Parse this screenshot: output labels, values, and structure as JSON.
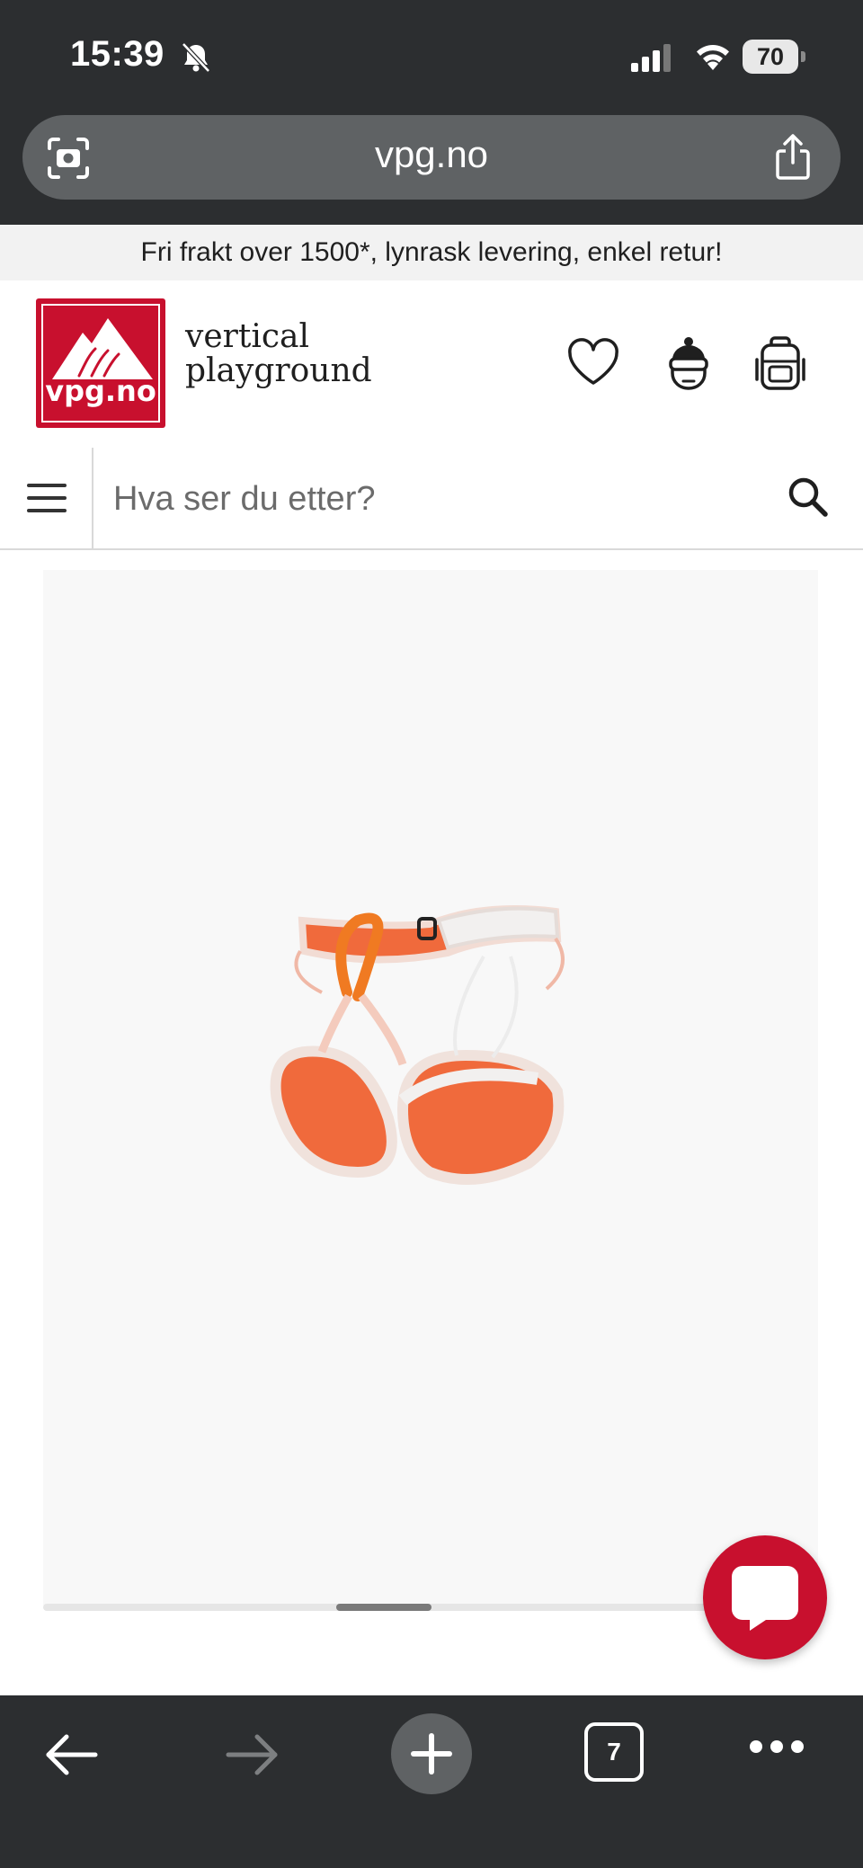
{
  "status_bar": {
    "time": "15:39",
    "battery": "70"
  },
  "browser": {
    "url": "vpg.no",
    "tab_count": "7"
  },
  "promo": {
    "text": "Fri frakt over 1500*, lynrask levering, enkel retur!"
  },
  "header": {
    "logo_text": "vpg.no",
    "brand_line1": "vertical",
    "brand_line2": "playground"
  },
  "search": {
    "placeholder": "Hva ser du etter?"
  },
  "colors": {
    "brand_red": "#c8102e",
    "browser_chrome": "#2c2e30"
  }
}
